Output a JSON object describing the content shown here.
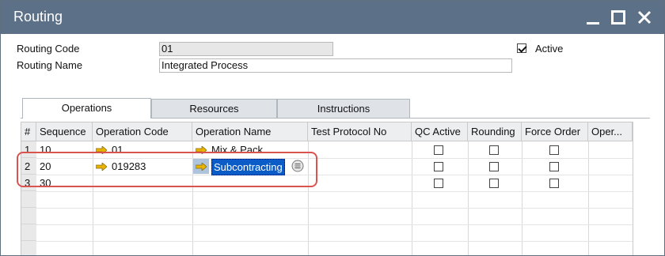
{
  "window": {
    "title": "Routing",
    "controls": [
      "minimize",
      "maximize",
      "close"
    ]
  },
  "header": {
    "routing_code_label": "Routing Code",
    "routing_code_value": "01",
    "routing_name_label": "Routing Name",
    "routing_name_value": "Integrated Process",
    "active_label": "Active",
    "active_checked": true
  },
  "tabs": [
    {
      "label": "Operations",
      "active": true
    },
    {
      "label": "Resources",
      "active": false
    },
    {
      "label": "Instructions",
      "active": false
    }
  ],
  "grid": {
    "columns": [
      "#",
      "Sequence",
      "Operation Code",
      "Operation Name",
      "Test Protocol No",
      "QC Active",
      "Rounding",
      "Force Order",
      "Oper..."
    ],
    "rows": [
      {
        "num": "1",
        "sequence": "10",
        "operation_code": "01",
        "operation_name": "Mix & Pack"
      },
      {
        "num": "2",
        "sequence": "20",
        "operation_code": "019283",
        "operation_name": "Subcontracting"
      },
      {
        "num": "3",
        "sequence": "30",
        "operation_code": "",
        "operation_name": ""
      }
    ]
  },
  "colors": {
    "titlebar": "#5c7087",
    "selection": "#0b5cc7",
    "highlight": "#d9534f",
    "link_arrow": "#e8b400"
  },
  "icons": [
    "minimize-icon",
    "maximize-icon",
    "close-icon",
    "link-arrow-icon",
    "choose-from-list-icon",
    "checkbox"
  ]
}
